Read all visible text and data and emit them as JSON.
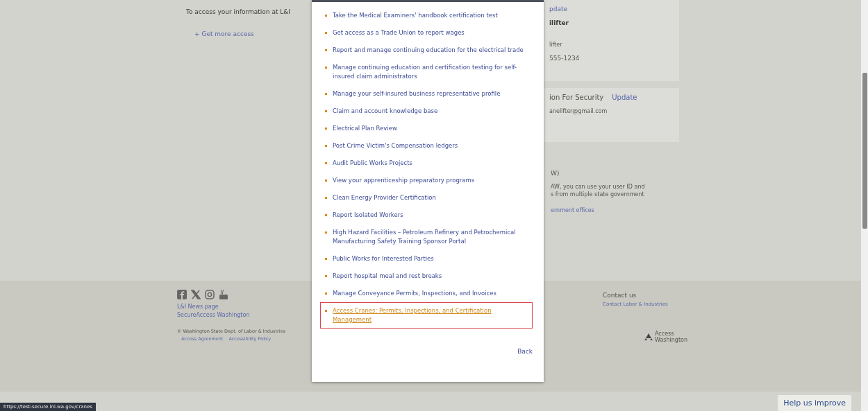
{
  "page": {
    "access_intro": "To access your information at L&I",
    "more_access_link": "+ Get more access"
  },
  "profile_card": {
    "update_link": "pdate",
    "name": "ilifter",
    "username": "lifter",
    "phone": "555-1234"
  },
  "security_card": {
    "title": "ion For Security",
    "update_link": "Update",
    "email": "anelifter@gmail.com"
  },
  "saw_section": {
    "title": "W)",
    "lines": [
      "AW, you can use your user ID and",
      "s from multiple state government"
    ],
    "link": "ernment offices"
  },
  "modal": {
    "items": [
      {
        "label": "Take the Medical Examiners' handbook certification test",
        "highlighted": false
      },
      {
        "label": "Get access as a Trade Union to report wages",
        "highlighted": false
      },
      {
        "label": "Report and manage continuing education for the electrical trade",
        "highlighted": false
      },
      {
        "label": "Manage continuing education and certification testing for self-insured claim administrators",
        "highlighted": false
      },
      {
        "label": "Manage your self-insured business representative profile",
        "highlighted": false
      },
      {
        "label": "Claim and account knowledge base",
        "highlighted": false
      },
      {
        "label": "Electrical Plan Review",
        "highlighted": false
      },
      {
        "label": "Post Crime Victim's Compensation ledgers",
        "highlighted": false
      },
      {
        "label": "Audit Public Works Projects",
        "highlighted": false
      },
      {
        "label": "View your apprenticeship preparatory programs",
        "highlighted": false
      },
      {
        "label": "Clean Energy Provider Certification",
        "highlighted": false
      },
      {
        "label": "Report Isolated Workers",
        "highlighted": false
      },
      {
        "label": "High Hazard Facilities – Petroleum Refinery and Petrochemical Manufacturing Safety Training Sponsor Portal",
        "highlighted": false
      },
      {
        "label": "Public Works for Interested Parties",
        "highlighted": false
      },
      {
        "label": "Report hospital meal and rest breaks",
        "highlighted": false
      },
      {
        "label": "Manage Conveyance Permits, Inspections, and Invoices",
        "highlighted": false
      },
      {
        "label": "Access Cranes: Permits, Inspections, and Certification Management",
        "highlighted": true
      }
    ],
    "back_link": "Back"
  },
  "footer": {
    "links": [
      "L&I News page",
      "SecureAccess Washington"
    ],
    "copyright": "© Washington State Dept. of Labor & Industries",
    "policy_links": [
      "Access Agreement",
      "Accessibility Policy"
    ],
    "contact_title": "Contact us",
    "contact_link": "Contact Labor & Industries",
    "logo_text": "Access Washington"
  },
  "status_url": "https://test-secure.lni.wa.gov/cranes",
  "help_button": "Help us improve"
}
